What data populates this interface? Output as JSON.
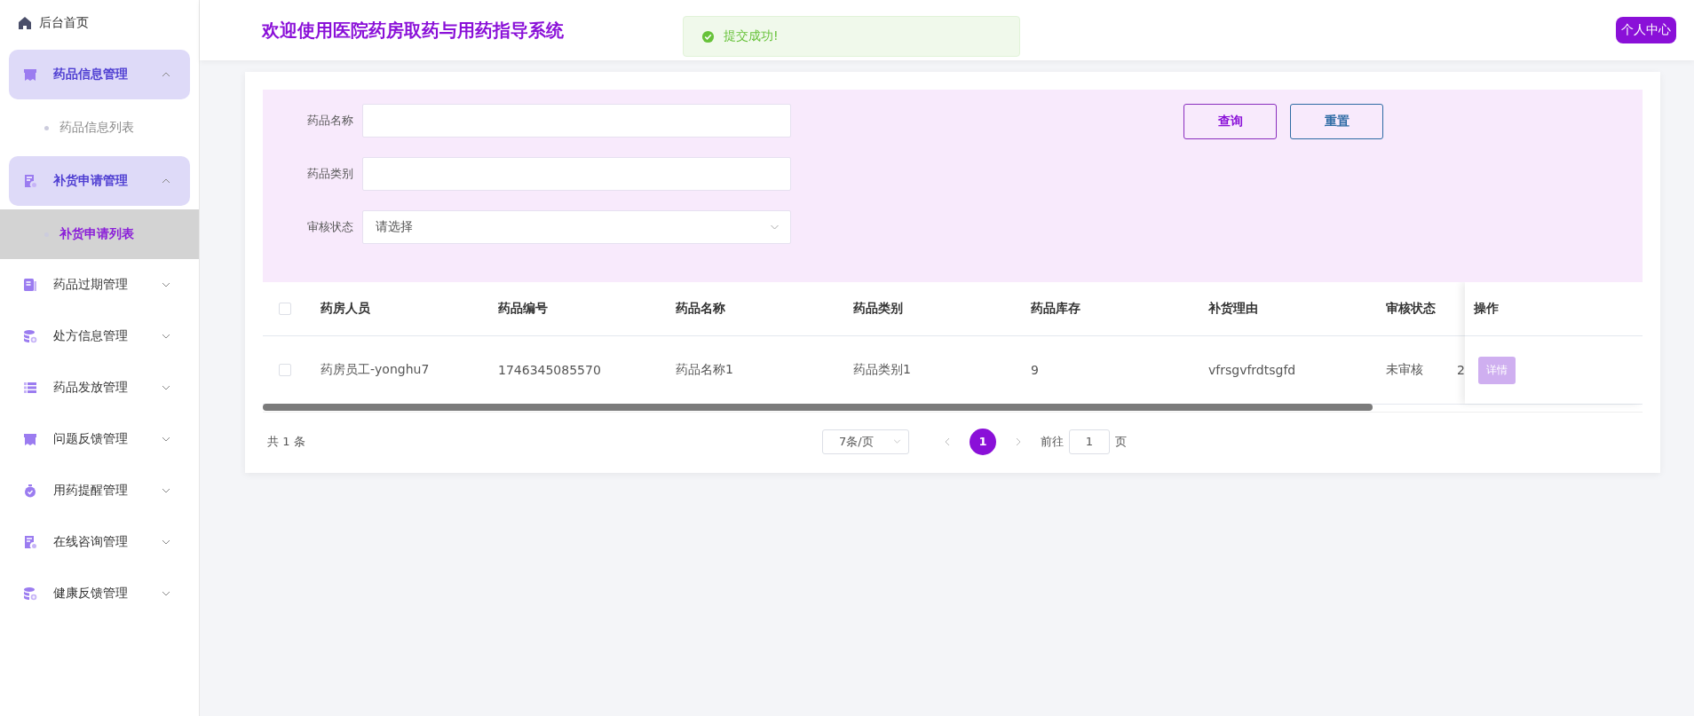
{
  "sidebar": {
    "items": [
      {
        "kind": "link",
        "label": "后台首页"
      },
      {
        "kind": "group",
        "label": "药品信息管理",
        "expanded": true,
        "children": [
          {
            "label": "药品信息列表",
            "selected": false
          }
        ]
      },
      {
        "kind": "group",
        "label": "补货申请管理",
        "expanded": true,
        "children": [
          {
            "label": "补货申请列表",
            "selected": true
          }
        ]
      },
      {
        "kind": "group",
        "label": "药品过期管理",
        "expanded": false
      },
      {
        "kind": "group",
        "label": "处方信息管理",
        "expanded": false
      },
      {
        "kind": "group",
        "label": "药品发放管理",
        "expanded": false
      },
      {
        "kind": "group",
        "label": "问题反馈管理",
        "expanded": false
      },
      {
        "kind": "group",
        "label": "用药提醒管理",
        "expanded": false
      },
      {
        "kind": "group",
        "label": "在线咨询管理",
        "expanded": false
      },
      {
        "kind": "group",
        "label": "健康反馈管理",
        "expanded": false
      }
    ]
  },
  "header": {
    "title": "欢迎使用医院药房取药与用药指导系统",
    "toast": "提交成功!",
    "user_button": "个人中心"
  },
  "filters": [
    {
      "kind": "input",
      "label": "药品名称"
    },
    {
      "kind": "input",
      "label": "药品类别"
    },
    {
      "kind": "select",
      "label": "审核状态",
      "placeholder": "请选择"
    }
  ],
  "buttons": [
    {
      "label": "查询",
      "kind": "primary"
    },
    {
      "label": "重置",
      "kind": "secondary"
    }
  ],
  "table": {
    "all_checked": false,
    "columns": [
      "药房人员",
      "药品编号",
      "药品名称",
      "药品类别",
      "药品库存",
      "补货理由",
      "审核状态"
    ],
    "action_column": "操作",
    "rows": [
      {
        "checked": false,
        "cells": [
          "药房员工-yonghu7",
          "1746345085570",
          "药品名称1",
          "药品类别1",
          "9",
          "vfrsgvfrdtsgfd",
          "未审核",
          "2"
        ],
        "action": "详情"
      }
    ]
  },
  "pagination": {
    "total": "共 1 条",
    "page_size": "7条/页",
    "pages": [
      {
        "label": "1",
        "selected": true
      }
    ],
    "goto_label": "前往",
    "goto_value": "1",
    "goto_suffix": "页"
  }
}
